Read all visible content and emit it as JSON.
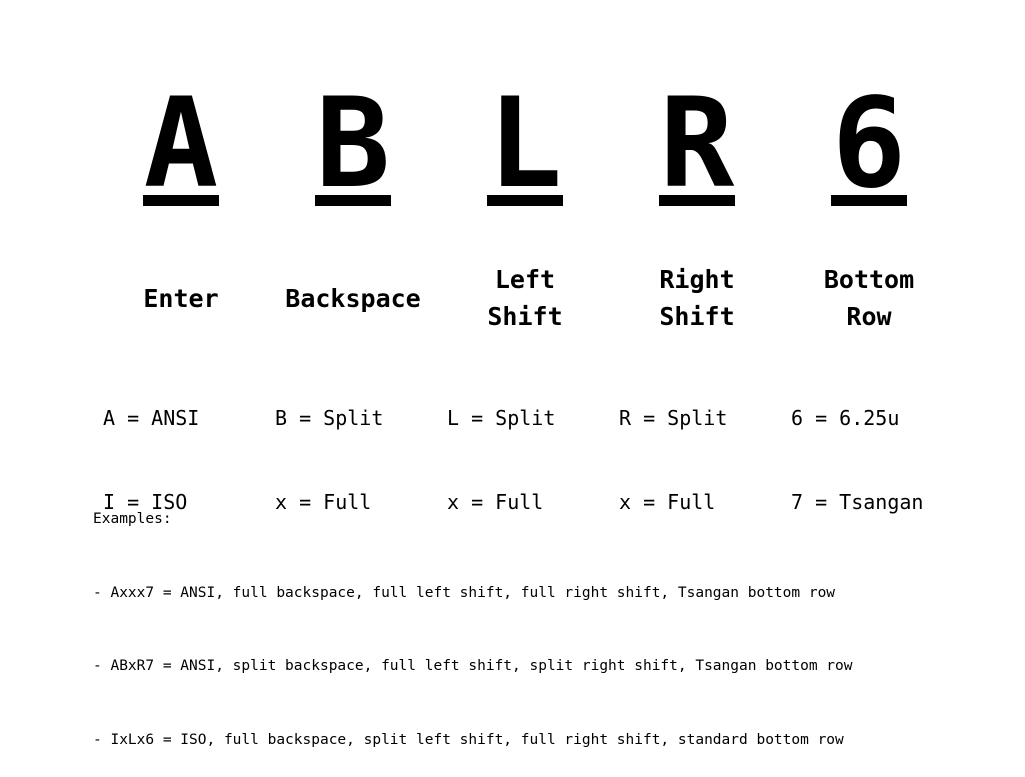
{
  "columns": [
    {
      "letter": "A",
      "heading": [
        "Enter"
      ],
      "legend": [
        "A = ANSI",
        "I = ISO"
      ]
    },
    {
      "letter": "B",
      "heading": [
        "Backspace"
      ],
      "legend": [
        "B = Split",
        "x = Full"
      ]
    },
    {
      "letter": "L",
      "heading": [
        "Left",
        "Shift"
      ],
      "legend": [
        "L = Split",
        "x = Full"
      ]
    },
    {
      "letter": "R",
      "heading": [
        "Right",
        "Shift"
      ],
      "legend": [
        "R = Split",
        "x = Full"
      ]
    },
    {
      "letter": "6",
      "heading": [
        "Bottom",
        "Row"
      ],
      "legend": [
        "6 = 6.25u",
        "7 = Tsangan"
      ]
    }
  ],
  "examples": {
    "title": "Examples:",
    "lines": [
      "- Axxx7 = ANSI, full backspace, full left shift, full right shift, Tsangan bottom row",
      "- ABxR7 = ANSI, split backspace, full left shift, split right shift, Tsangan bottom row",
      "- IxLx6 = ISO, full backspace, split left shift, full right shift, standard bottom row"
    ]
  }
}
